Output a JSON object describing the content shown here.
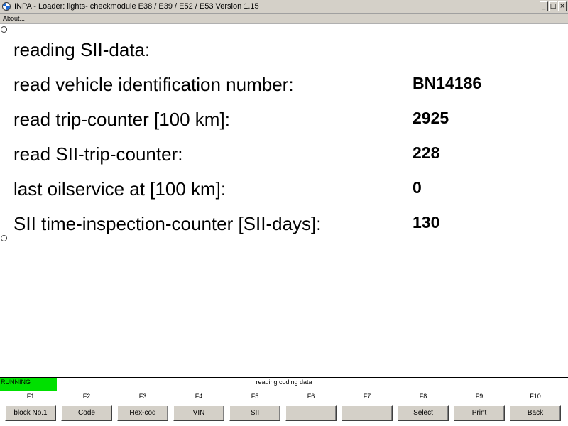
{
  "window": {
    "title": "INPA - Loader:  lights- checkmodule E38 / E39 / E52 / E53 Version 1.15",
    "min_glyph": "_",
    "max_glyph": "□",
    "close_glyph": "×"
  },
  "menu": {
    "about": "About..."
  },
  "content": {
    "heading": "reading SII-data:",
    "rows": [
      {
        "label": "read vehicle identification number:",
        "value": "BN14186"
      },
      {
        "label": "read trip-counter [100 km]:",
        "value": "2925"
      },
      {
        "label": "read SII-trip-counter:",
        "value": "228"
      },
      {
        "label": "last oilservice at [100 km]:",
        "value": "0"
      },
      {
        "label": "SII time-inspection-counter [SII-days]:",
        "value": "130"
      }
    ]
  },
  "status": {
    "state": "RUNNING",
    "state_color": "#00e000",
    "message": "reading coding data"
  },
  "fkeys": [
    {
      "key": "F1",
      "label": "block No.1"
    },
    {
      "key": "F2",
      "label": "Code"
    },
    {
      "key": "F3",
      "label": "Hex-cod"
    },
    {
      "key": "F4",
      "label": "VIN"
    },
    {
      "key": "F5",
      "label": "SII"
    },
    {
      "key": "F6",
      "label": ""
    },
    {
      "key": "F7",
      "label": ""
    },
    {
      "key": "F8",
      "label": "Select"
    },
    {
      "key": "F9",
      "label": "Print"
    },
    {
      "key": "F10",
      "label": "Back"
    }
  ]
}
